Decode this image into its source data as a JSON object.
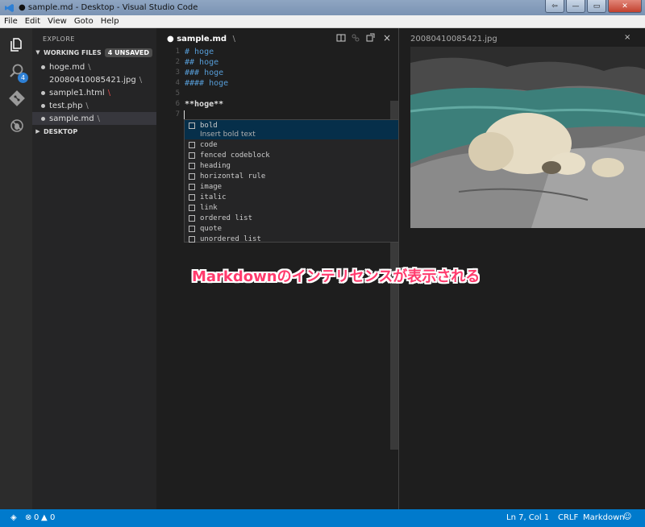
{
  "window": {
    "title": "● sample.md - Desktop - Visual Studio Code",
    "controls": {
      "back": "⇦",
      "minimize": "—",
      "maximize": "▭",
      "close": "✕"
    }
  },
  "menu": [
    "File",
    "Edit",
    "View",
    "Goto",
    "Help"
  ],
  "activity_bar": {
    "icons": [
      "files-icon",
      "search-icon",
      "git-icon",
      "debug-icon"
    ],
    "badge": "4"
  },
  "sidebar": {
    "title": "EXPLORE",
    "working_files": {
      "label": "WORKING FILES",
      "badge": "4 UNSAVED",
      "items": [
        {
          "name": "hoge.md",
          "dirty": true,
          "slash": "\\"
        },
        {
          "name": "20080410085421.jpg",
          "dirty": false,
          "slash": "\\"
        },
        {
          "name": "sample1.html",
          "dirty": true,
          "slash": "\\"
        },
        {
          "name": "test.php",
          "dirty": true,
          "slash": "\\"
        },
        {
          "name": "sample.md",
          "dirty": true,
          "slash": "\\"
        }
      ]
    },
    "desktop": {
      "label": "DESKTOP"
    }
  },
  "editor": {
    "tab_name": "● sample.md",
    "tab_slash": "\\",
    "close": "×",
    "lines": [
      {
        "num": "1",
        "text": "# hoge"
      },
      {
        "num": "2",
        "text": "## hoge"
      },
      {
        "num": "3",
        "text": "### hoge"
      },
      {
        "num": "4",
        "text": "#### hoge"
      },
      {
        "num": "5",
        "text": ""
      },
      {
        "num": "6",
        "text": "**hoge**"
      },
      {
        "num": "7",
        "text": ""
      }
    ]
  },
  "suggest": {
    "selected_description": "Insert bold text",
    "items": [
      "bold",
      "code",
      "fenced codeblock",
      "heading",
      "horizontal rule",
      "image",
      "italic",
      "link",
      "ordered list",
      "quote",
      "unordered list"
    ]
  },
  "preview": {
    "title": "20080410085421.jpg",
    "close": "×"
  },
  "annotation": "Markdownのインテリセンスが表示される",
  "statusbar": {
    "errors": "0",
    "warnings": "0",
    "position": "Ln 7, Col 1",
    "eol": "CRLF",
    "language": "Markdown"
  },
  "colors": {
    "accent": "#007acc",
    "annotation": "#ff3b6d",
    "markdown_header": "#569cd6"
  }
}
